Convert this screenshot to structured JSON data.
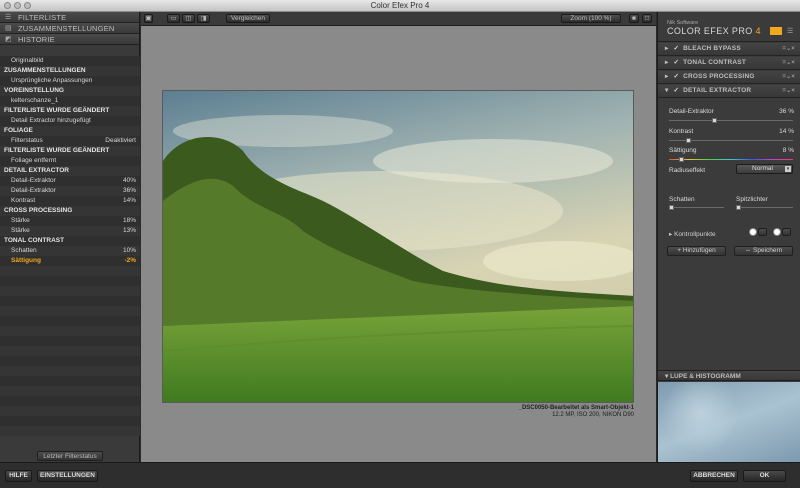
{
  "window": {
    "title": "Color Efex Pro 4"
  },
  "left_panel": {
    "filterlist_label": "FILTERLISTE",
    "recipes_label": "ZUSAMMENSTELLUNGEN",
    "history_label": "HISTORIE",
    "history": [
      {
        "label": "Originalbild",
        "level": "sub",
        "value": ""
      },
      {
        "label": "ZUSAMMENSTELLUNGEN",
        "level": "sec",
        "value": ""
      },
      {
        "label": "Ursprüngliche Anpassungen",
        "level": "sub",
        "value": ""
      },
      {
        "label": "VOREINSTELLUNG",
        "level": "sec",
        "value": ""
      },
      {
        "label": "kelterschanze_1",
        "level": "sub",
        "value": ""
      },
      {
        "label": "FILTERLISTE WURDE GEÄNDERT",
        "level": "sec",
        "value": ""
      },
      {
        "label": "Detail Extractor hinzugefügt",
        "level": "sub",
        "value": ""
      },
      {
        "label": "FOLIAGE",
        "level": "sec",
        "value": ""
      },
      {
        "label": "Filterstatus",
        "level": "sub",
        "value": "Deaktiviert"
      },
      {
        "label": "FILTERLISTE WURDE GEÄNDERT",
        "level": "sec",
        "value": ""
      },
      {
        "label": "Foliage entfernt",
        "level": "sub",
        "value": ""
      },
      {
        "label": "DETAIL EXTRACTOR",
        "level": "sec",
        "value": ""
      },
      {
        "label": "Detail-Extraktor",
        "level": "sub",
        "value": "40%"
      },
      {
        "label": "Detail-Extraktor",
        "level": "sub",
        "value": "36%"
      },
      {
        "label": "Kontrast",
        "level": "sub",
        "value": "14%"
      },
      {
        "label": "CROSS PROCESSING",
        "level": "sec",
        "value": ""
      },
      {
        "label": "Stärke",
        "level": "sub",
        "value": "18%"
      },
      {
        "label": "Stärke",
        "level": "sub",
        "value": "13%"
      },
      {
        "label": "TONAL CONTRAST",
        "level": "sec",
        "value": ""
      },
      {
        "label": "Schatten",
        "level": "sub",
        "value": "10%"
      },
      {
        "label": "Sättigung",
        "level": "sub",
        "value": "-2%",
        "active": true
      }
    ],
    "last_state_button": "Letzter Filterstatus"
  },
  "canvas": {
    "compare_label": "Vergleichen",
    "zoom_label": "Zoom (100 %)",
    "caption_line1": "_DSC0050-Bearbeitet als Smart-Objekt-1",
    "caption_line2": "12.2 MP, ISO 200, NIKON D90"
  },
  "right_panel": {
    "nik_label": "Nik Software",
    "product_name": "COLOR EFEX PRO",
    "product_version": "4",
    "filters": [
      {
        "label": "BLEACH BYPASS"
      },
      {
        "label": "TONAL CONTRAST"
      },
      {
        "label": "CROSS PROCESSING"
      },
      {
        "label": "DETAIL EXTRACTOR"
      }
    ],
    "sliders": {
      "detail_label": "Detail-Extraktor",
      "detail_value": "36",
      "detail_unit": "%",
      "detail_level": 0.36,
      "contrast_label": "Kontrast",
      "contrast_value": "14",
      "contrast_unit": "%",
      "contrast_level": 0.14,
      "saturation_label": "Sättigung",
      "saturation_value": "8",
      "saturation_unit": "%",
      "saturation_level": 0.08
    },
    "radius_label": "Radiuseffekt",
    "radius_value": "Normal",
    "shadows_label": "Schatten",
    "highlights_label": "Spitzlichter",
    "control_points_label": "Kontrollpunkte",
    "add_button": "Hinzufügen",
    "save_button": "Speichern",
    "loupe_label": "LUPE & HISTOGRAMM"
  },
  "bottom": {
    "help_button": "HILFE",
    "settings_button": "EINSTELLUNGEN",
    "cancel_button": "ABBRECHEN",
    "ok_button": "OK"
  },
  "colors": {
    "accent": "#f2a81d",
    "panel": "#3a3a3a",
    "canvas": "#8a8a8a"
  }
}
